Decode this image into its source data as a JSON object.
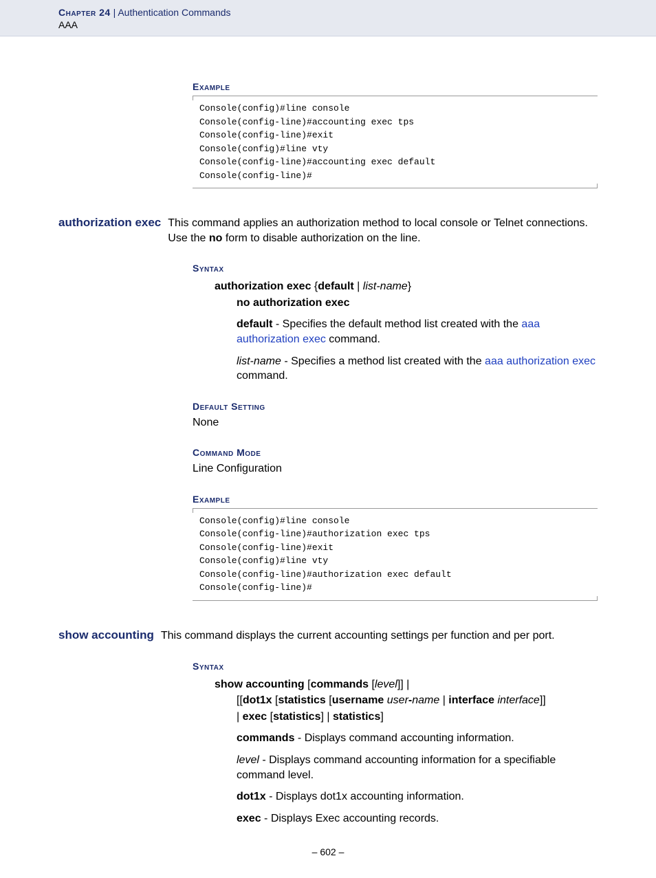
{
  "header": {
    "chapter_label": "Chapter 24",
    "separator": "  |  ",
    "chapter_title": "Authentication Commands",
    "sub": "AAA"
  },
  "sec1": {
    "heading_example": "Example",
    "code": "Console(config)#line console\nConsole(config-line)#accounting exec tps\nConsole(config-line)#exit\nConsole(config)#line vty\nConsole(config-line)#accounting exec default\nConsole(config-line)#"
  },
  "cmd1": {
    "name": "authorization exec",
    "desc_pre": "This command applies an authorization method to local console or Telnet connections. Use the ",
    "desc_bold": "no",
    "desc_post": " form to disable authorization on the line.",
    "heading_syntax": "Syntax",
    "syntax_cmd": "authorization exec",
    "syntax_lb": " {",
    "syntax_default": "default",
    "syntax_pipe": " | ",
    "syntax_listname": "list-name",
    "syntax_rb": "}",
    "syntax_no": "no authorization exec",
    "p_default_bold": "default",
    "p_default_rest": " - Specifies the default method list created with the ",
    "p_default_link": "aaa authorization exec",
    "p_default_cmd": " command.",
    "p_list_italic": "list-name",
    "p_list_rest": " - Specifies a method list created with the ",
    "p_list_link": "aaa authorization exec",
    "p_list_cmd": " command.",
    "heading_default": "Default Setting",
    "default_val": "None",
    "heading_mode": "Command Mode",
    "mode_val": "Line Configuration",
    "heading_example": "Example",
    "code": "Console(config)#line console\nConsole(config-line)#authorization exec tps\nConsole(config-line)#exit\nConsole(config)#line vty\nConsole(config-line)#authorization exec default\nConsole(config-line)#"
  },
  "cmd2": {
    "name": "show accounting",
    "desc": "This command displays the current accounting settings per function and per port.",
    "heading_syntax": "Syntax",
    "s_show": "show accounting",
    "s_lb": " [",
    "s_commands": "commands",
    "s_lb2": " [",
    "s_level": "level",
    "s_rb2": "]] |",
    "s_line2_lb": "[[",
    "s_dot1x": "dot1x",
    "s_lb3": " [",
    "s_statistics": "statistics",
    "s_lb4": " [",
    "s_username": "username",
    "s_sp": " ",
    "s_usern": "user",
    "s_hy": "-",
    "s_namei": "name",
    "s_pipe": " | ",
    "s_interface": "interface",
    "s_sp2": " ",
    "s_intfi": "interface",
    "s_rb3": "]]",
    "s_line3_pipe": "| ",
    "s_exec": "exec",
    "s_lb5": " [",
    "s_stats2": "statistics",
    "s_rb5": "] | ",
    "s_stats3": "statistics",
    "s_rb6": "]",
    "p_commands_b": "commands",
    "p_commands_r": " - Displays command accounting information.",
    "p_level_i": "level",
    "p_level_r": " - Displays command accounting information for a specifiable command level.",
    "p_dot1x_b": "dot1x",
    "p_dot1x_r": " - Displays dot1x accounting information.",
    "p_exec_b": "exec",
    "p_exec_r": " - Displays Exec accounting records."
  },
  "page": "–  602  –"
}
